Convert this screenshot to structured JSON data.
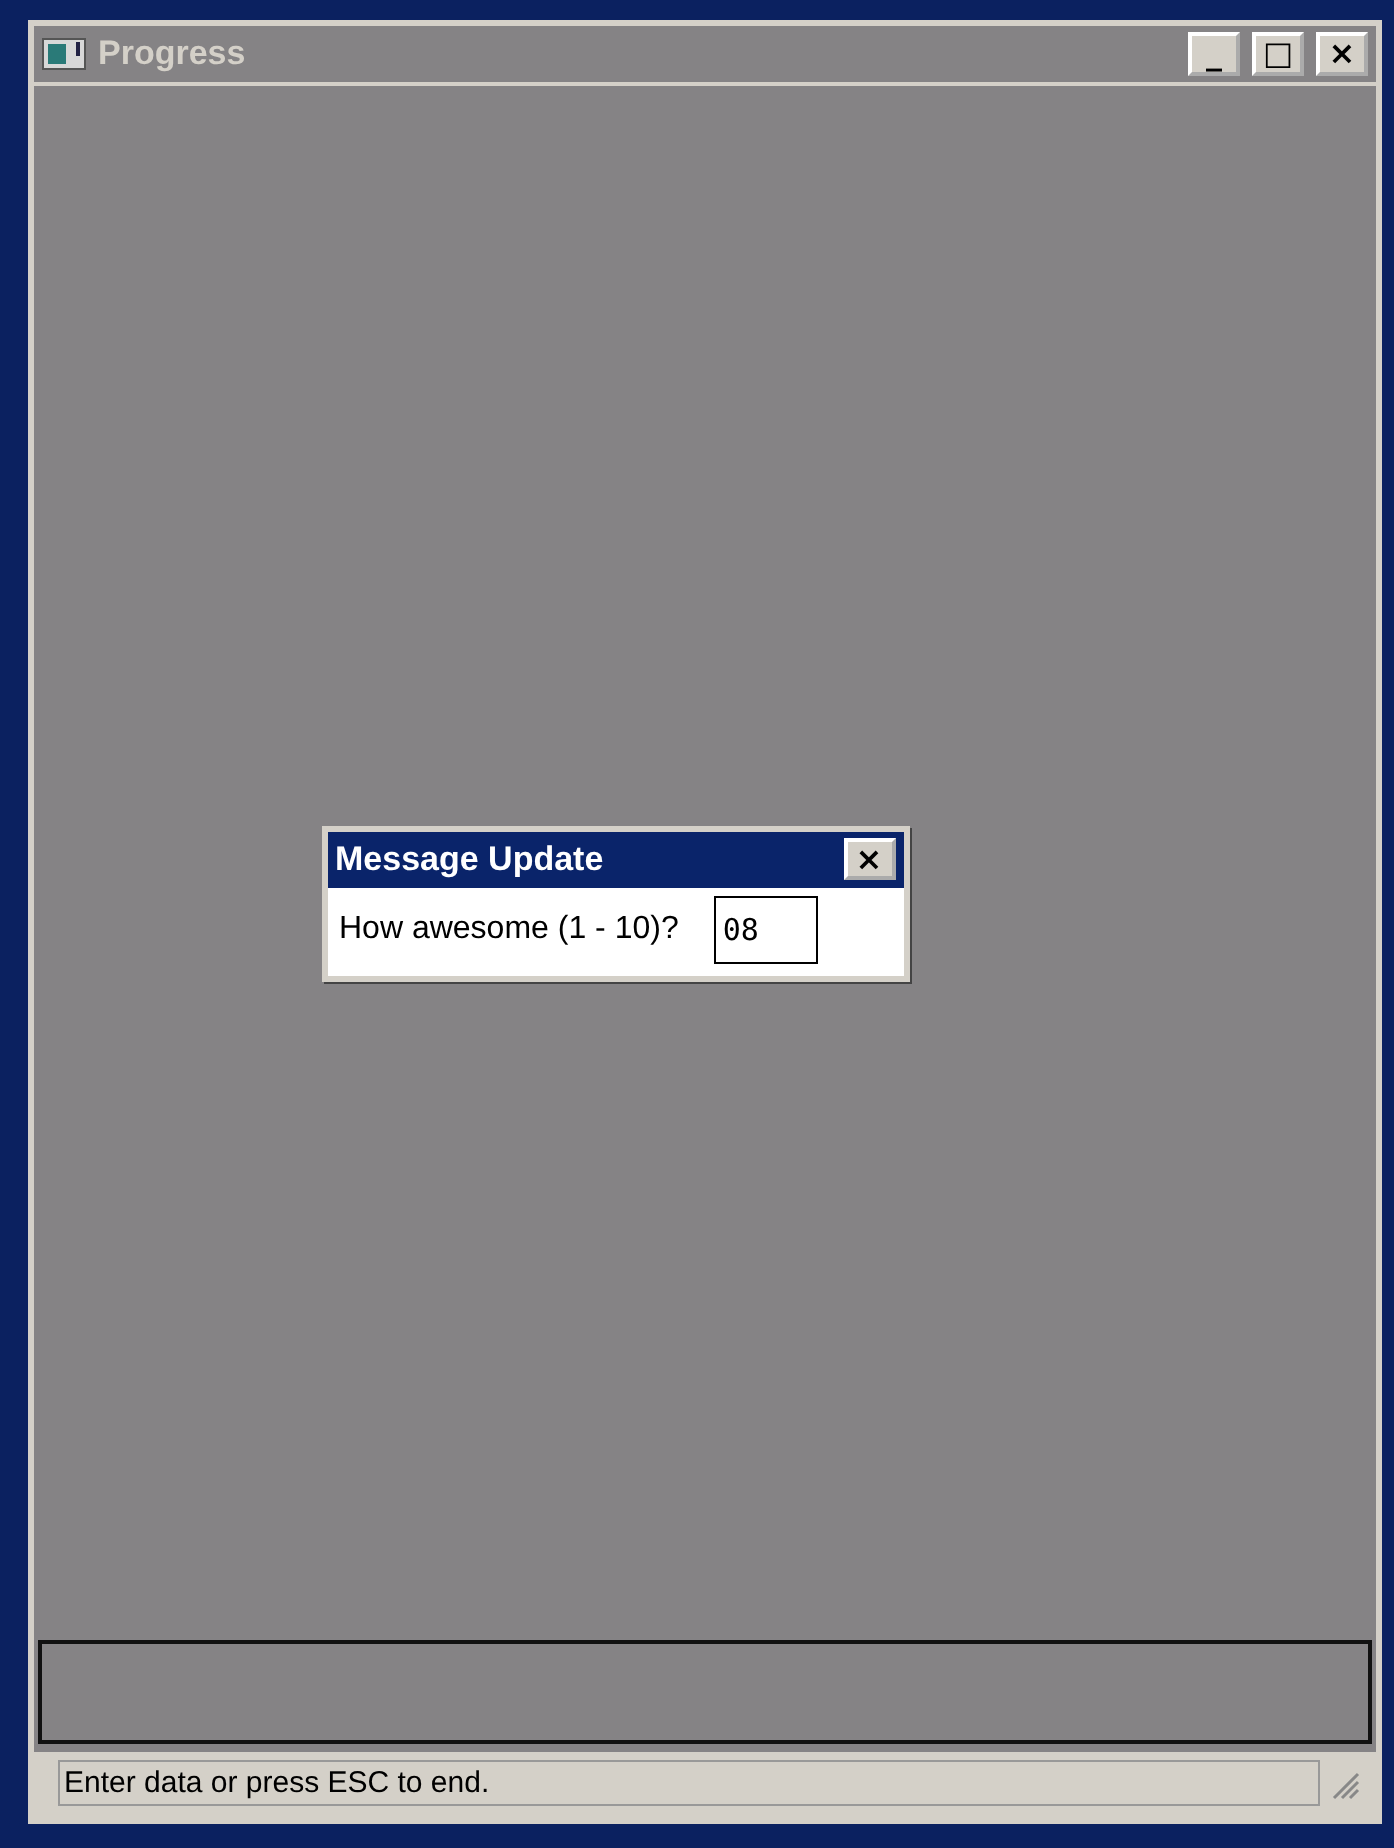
{
  "window": {
    "title": "Progress",
    "active": false,
    "buttons": [
      "_",
      "□",
      "×"
    ]
  },
  "dialog": {
    "title": "Message Update",
    "close": "×",
    "prompt": "How awesome (1 - 10)?",
    "value": "08"
  },
  "status_bar": {
    "text": "Enter data or press ESC to end."
  }
}
